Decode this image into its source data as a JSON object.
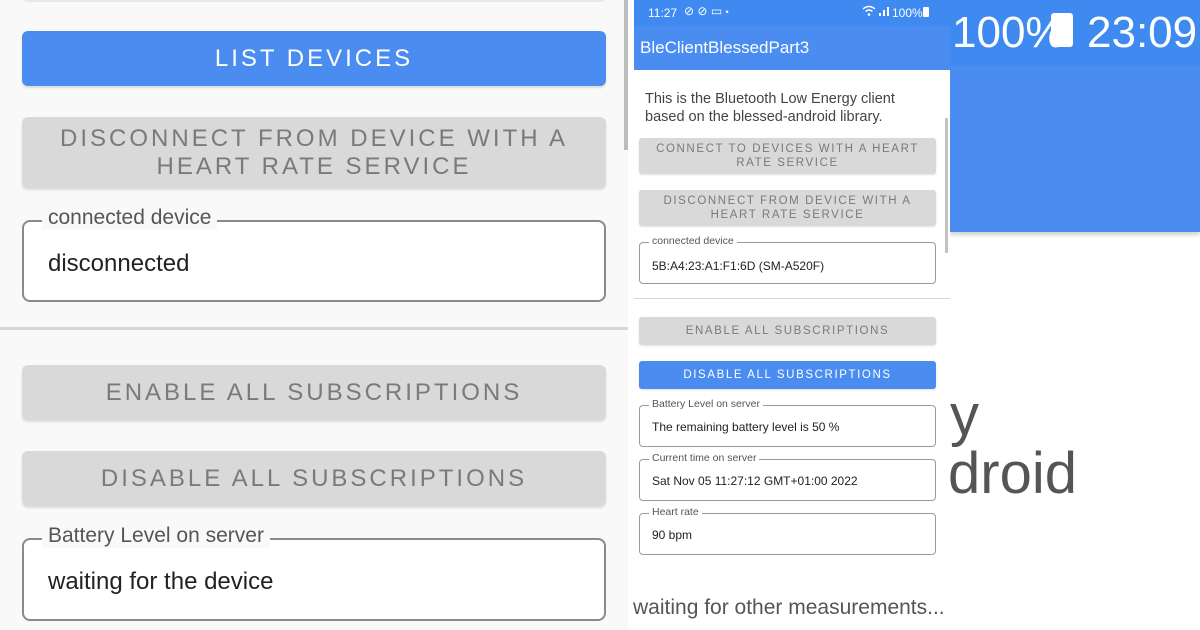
{
  "left": {
    "list_devices": "LIST DEVICES",
    "disconnect_line1": "DISCONNECT FROM DEVICE WITH A",
    "disconnect_line2": "HEART RATE SERVICE",
    "connected_device_label": "connected device",
    "connected_device_value": "disconnected",
    "enable_all": "ENABLE ALL SUBSCRIPTIONS",
    "disable_all": "DISABLE ALL SUBSCRIPTIONS",
    "battery_label": "Battery Level on server",
    "battery_value": "waiting for the device"
  },
  "phone": {
    "status": {
      "time": "11:27",
      "battery": "100%"
    },
    "app_title": "BleClientBlessedPart3",
    "intro_text": "This is the Bluetooth Low Energy client based on the blessed-android library.",
    "connect_line1": "CONNECT TO DEVICES WITH A HEART",
    "connect_line2": "RATE SERVICE",
    "disconnect_line1": "DISCONNECT FROM DEVICE WITH A",
    "disconnect_line2": "HEART RATE SERVICE",
    "connected_device_label": "connected device",
    "connected_device_value": "5B:A4:23:A1:F1:6D (SM-A520F)",
    "enable_all": "ENABLE ALL SUBSCRIPTIONS",
    "disable_all": "DISABLE ALL SUBSCRIPTIONS",
    "battery_label": "Battery Level on server",
    "battery_value": "The remaining battery level is 50 %",
    "time_label": "Current time on server",
    "time_value": "Sat Nov 05 11:27:12 GMT+01:00 2022",
    "heart_label": "Heart rate",
    "heart_value": "90 bpm"
  },
  "right": {
    "status_battery": "100%",
    "status_time": "23:09",
    "fragment1": "y",
    "fragment2": "droid"
  },
  "bottom_message": "waiting for other measurements...",
  "colors": {
    "primary": "#4a8cf0",
    "status_bar": "#3f8af0",
    "button_gray": "#d9d9d9"
  },
  "icons": [
    "link-icon",
    "link-icon",
    "cast-icon",
    "dot-icon",
    "wifi-icon",
    "signal-icon",
    "battery-icon"
  ]
}
